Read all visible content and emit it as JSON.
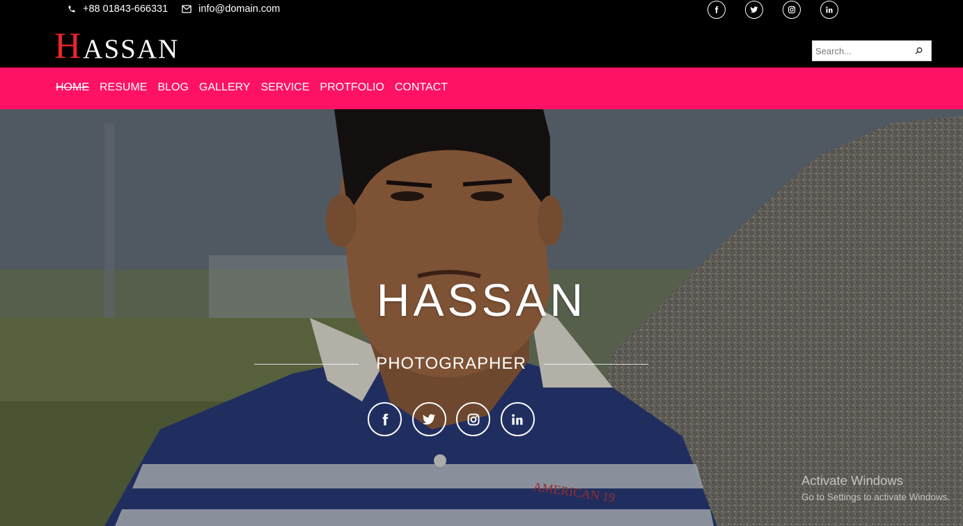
{
  "header": {
    "phone": "+88 01843-666331",
    "email": "info@domain.com",
    "social_icons": [
      "facebook-icon",
      "twitter-icon",
      "instagram-icon",
      "linkedin-icon"
    ],
    "logo_first": "H",
    "logo_rest": "ASSAN",
    "search_placeholder": "Search..."
  },
  "nav": {
    "items": [
      "HOME",
      "RESUME",
      "BLOG",
      "GALLERY",
      "SERVICE",
      "PROTFOLIO",
      "CONTACT"
    ],
    "active": "HOME"
  },
  "hero": {
    "title": "HASSAN",
    "subtitle": "PHOTOGRAPHER",
    "social_icons": [
      "facebook-icon",
      "twitter-icon",
      "instagram-icon",
      "linkedin-icon"
    ],
    "photo": "portrait-photo",
    "shirt_print": "AMERICAN 19"
  },
  "os_watermark": {
    "line1": "Activate Windows",
    "line2": "Go to Settings to activate Windows."
  },
  "colors": {
    "topbar": "#000000",
    "nav": "#ff1166",
    "logo_accent": "#e8262c",
    "text": "#ffffff"
  }
}
